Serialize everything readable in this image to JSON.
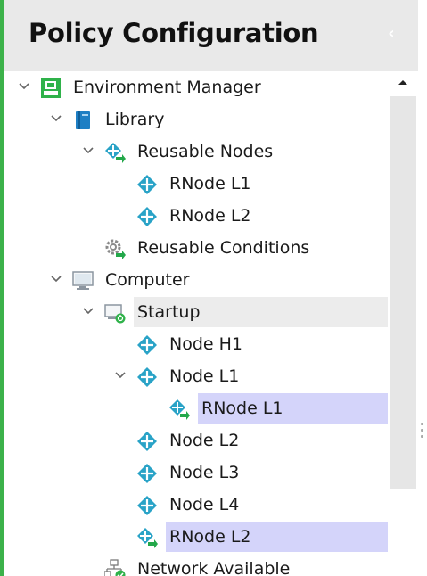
{
  "panel": {
    "title": "Policy Configuration",
    "collapse_icon": "chevron-left-icon"
  },
  "tree": {
    "nodes": [
      {
        "label": "Environment Manager",
        "icon": "environment-manager-icon",
        "expanded": true
      },
      {
        "label": "Library",
        "icon": "library-book-icon",
        "expanded": true
      },
      {
        "label": "Reusable Nodes",
        "icon": "reusable-nodes-icon",
        "expanded": true
      },
      {
        "label": "RNode L1",
        "icon": "node-diamond-icon"
      },
      {
        "label": "RNode L2",
        "icon": "node-diamond-icon"
      },
      {
        "label": "Reusable Conditions",
        "icon": "reusable-conditions-gear-icon"
      },
      {
        "label": "Computer",
        "icon": "computer-monitor-icon",
        "expanded": true
      },
      {
        "label": "Startup",
        "icon": "startup-icon",
        "expanded": true,
        "highlight": "gray"
      },
      {
        "label": "Node H1",
        "icon": "node-diamond-icon"
      },
      {
        "label": "Node L1",
        "icon": "node-diamond-icon",
        "expanded": true
      },
      {
        "label": "RNode L1",
        "icon": "reusable-node-link-icon",
        "highlight": "blue"
      },
      {
        "label": "Node L2",
        "icon": "node-diamond-icon"
      },
      {
        "label": "Node L3",
        "icon": "node-diamond-icon"
      },
      {
        "label": "Node L4",
        "icon": "node-diamond-icon"
      },
      {
        "label": "RNode L2",
        "icon": "reusable-node-link-icon",
        "highlight": "blue"
      },
      {
        "label": "Network Available",
        "icon": "network-available-icon"
      }
    ]
  },
  "colors": {
    "accent_green": "#3cb24a",
    "node_teal": "#2aa3c7",
    "selection_blue": "#d4d4fa",
    "selection_gray": "#ececec",
    "header_bg": "#e9e9e9"
  }
}
